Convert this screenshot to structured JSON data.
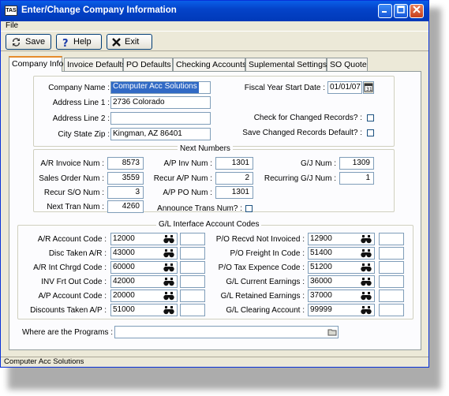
{
  "window": {
    "icon_text": "TAS",
    "title": "Enter/Change Company Information"
  },
  "menu": {
    "file": "File"
  },
  "toolbar": {
    "save": "Save",
    "help": "Help",
    "exit": "Exit"
  },
  "tabs": [
    "Company Info",
    "Invoice Defaults",
    "PO Defaults",
    "Checking Accounts",
    "Suplemental Settings",
    "SO Quote"
  ],
  "company": {
    "name_label": "Company Name :",
    "name": "Computer Acc Solutions",
    "addr1_label": "Address Line 1 :",
    "addr1": "2736 Colorado",
    "addr2_label": "Address Line 2 :",
    "addr2": "",
    "city_label": "City State Zip :",
    "city": "Kingman, AZ 86401",
    "fiscal_label": "Fiscal Year Start Date :",
    "fiscal": "01/01/07",
    "check_changed_label": "Check for Changed Records? :",
    "save_changed_label": "Save Changed Records Default? :"
  },
  "next_numbers": {
    "title": "Next Numbers",
    "ar_invoice_label": "A/R Invoice Num :",
    "ar_invoice": "8573",
    "sales_order_label": "Sales Order Num :",
    "sales_order": "3559",
    "recur_so_label": "Recur S/O Num :",
    "recur_so": "3",
    "next_tran_label": "Next Tran Num :",
    "next_tran": "4260",
    "ap_inv_label": "A/P Inv Num :",
    "ap_inv": "1301",
    "recur_ap_label": "Recur A/P Num :",
    "recur_ap": "2",
    "ap_po_label": "A/P PO Num :",
    "ap_po": "1301",
    "announce_label": "Announce Trans Num? :",
    "gj_label": "G/J Num :",
    "gj": "1309",
    "recurring_gj_label": "Recurring G/J Num :",
    "recurring_gj": "1"
  },
  "gl": {
    "title": "G/L Interface Account Codes",
    "left": [
      {
        "label": "A/R Account Code :",
        "value": "12000"
      },
      {
        "label": "Disc Taken A/R :",
        "value": "43000"
      },
      {
        "label": "A/R Int Chrgd Code :",
        "value": "60000"
      },
      {
        "label": "INV Frt Out Code :",
        "value": "42000"
      },
      {
        "label": "A/P Account Code :",
        "value": "20000"
      },
      {
        "label": "Discounts Taken A/P :",
        "value": "51000"
      }
    ],
    "right": [
      {
        "label": "P/O Recvd Not Invoiced :",
        "value": "12900"
      },
      {
        "label": "P/O Freight In Code :",
        "value": "51400"
      },
      {
        "label": "P/O Tax Expence Code :",
        "value": "51200"
      },
      {
        "label": "G/L Current Earnings :",
        "value": "36000"
      },
      {
        "label": "G/L Retained Earnings :",
        "value": "37000"
      },
      {
        "label": "G/L Clearing Account :",
        "value": "99999"
      }
    ]
  },
  "programs": {
    "label": "Where are the Programs :",
    "value": ""
  },
  "status": {
    "text": "Computer Acc Solutions"
  }
}
